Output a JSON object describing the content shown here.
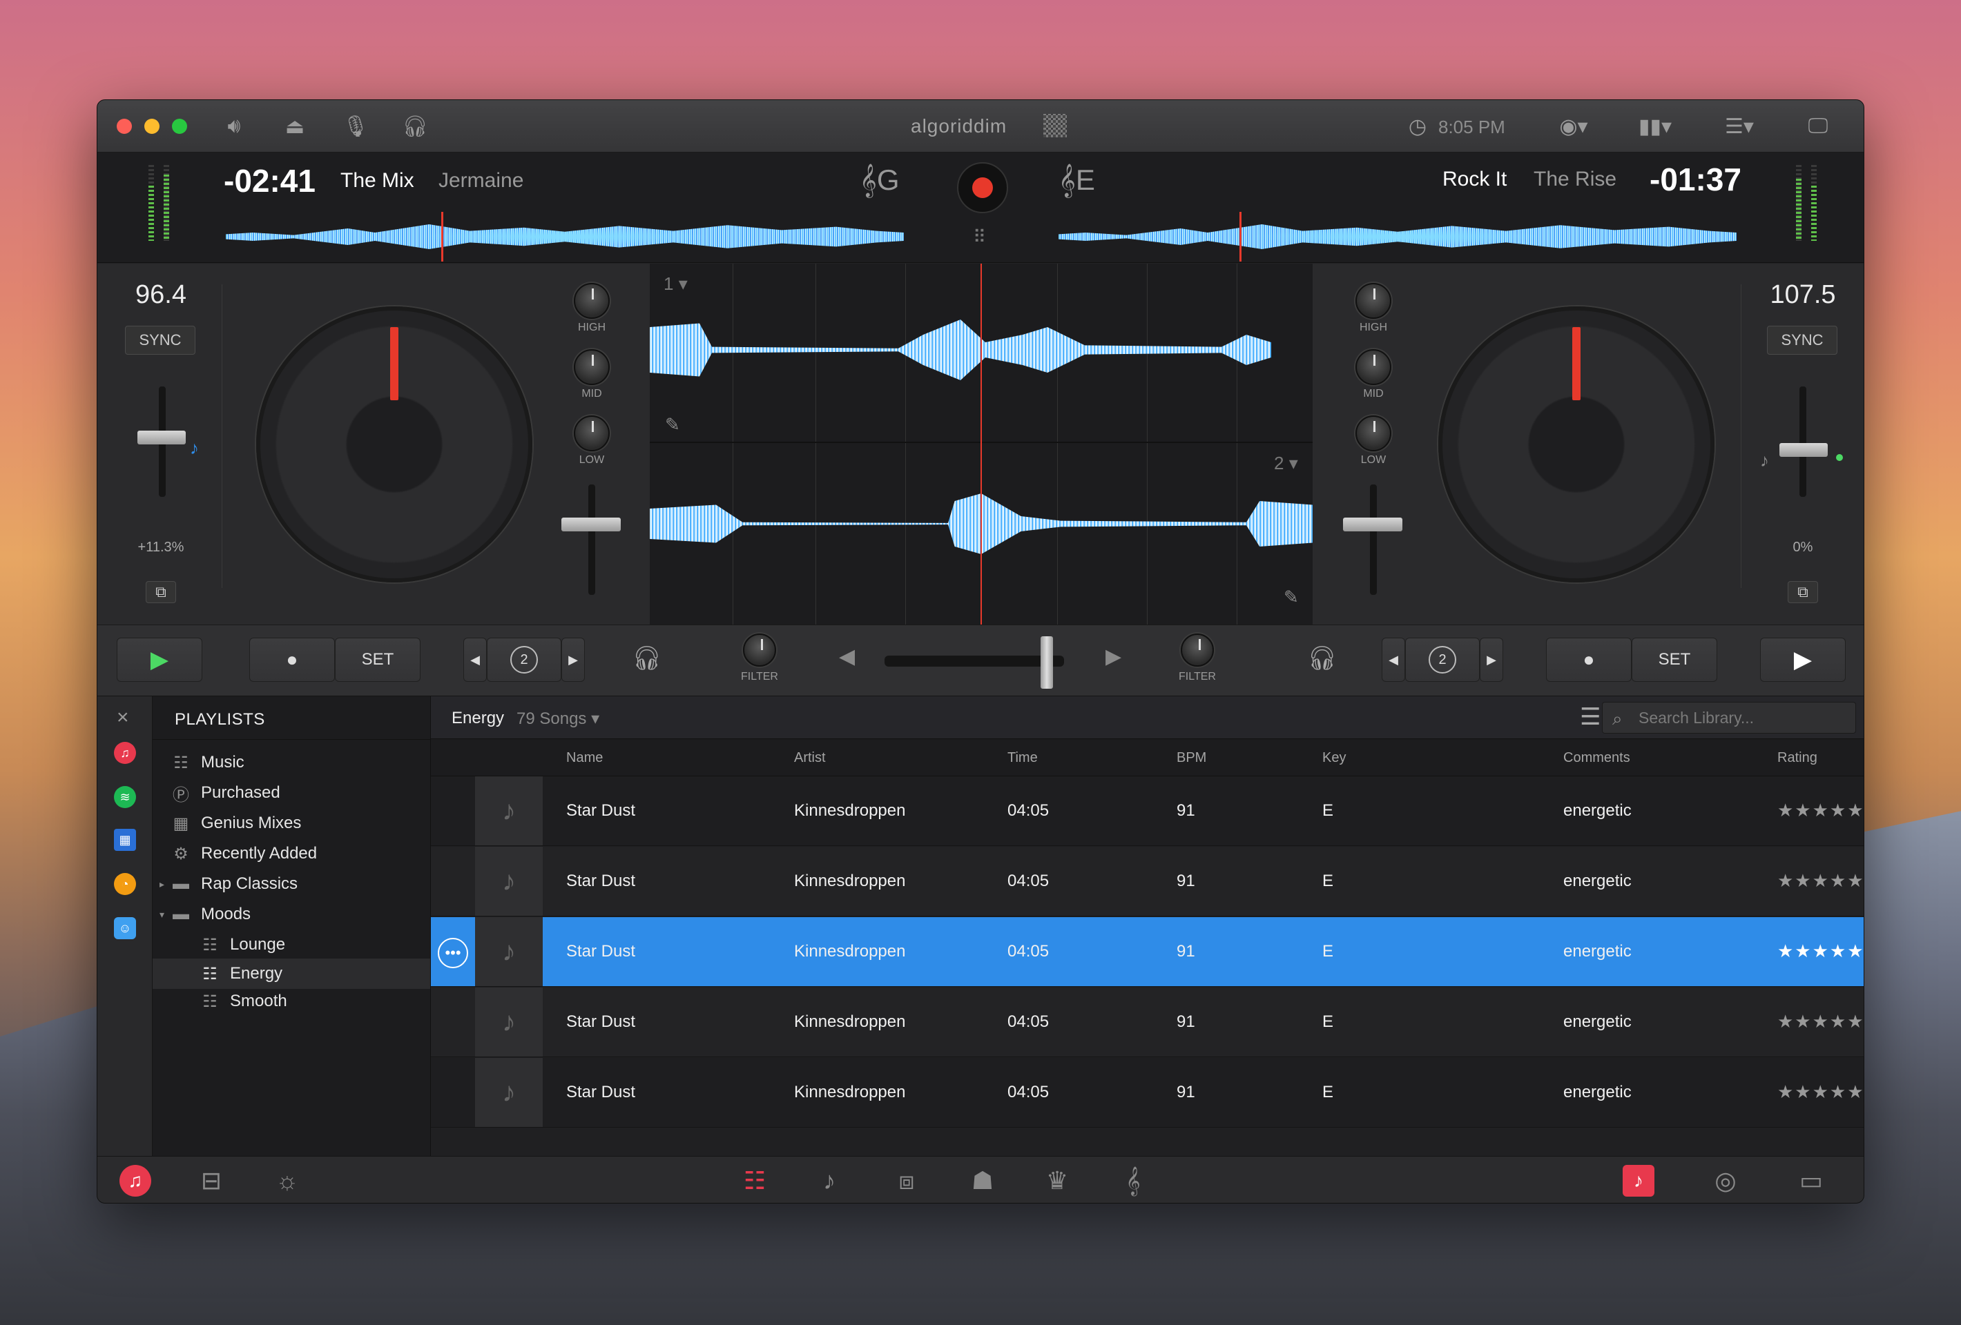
{
  "titlebar": {
    "app_logo": "algoriddim",
    "clock": "8:05 PM",
    "accent": "#e8392b"
  },
  "deck_left": {
    "time": "-02:41",
    "track": "The Mix",
    "artist": "Jermaine",
    "key": "G",
    "bpm": "96.4",
    "sync_label": "SYNC",
    "pitch": "+11.3%"
  },
  "deck_right": {
    "time": "-01:37",
    "track": "Rock It",
    "artist": "The Rise",
    "key": "E",
    "bpm": "107.5",
    "sync_label": "SYNC",
    "pitch": "0%"
  },
  "mixer": {
    "high": "HIGH",
    "mid": "MID",
    "low": "LOW",
    "filter": "FILTER",
    "deck1_num": "1",
    "deck2_num": "2"
  },
  "transport": {
    "set_label": "SET",
    "loop_value": "2"
  },
  "sources": [
    "itunes-icon",
    "spotify-icon",
    "video-icon",
    "history-icon",
    "finder-icon"
  ],
  "playlists": {
    "header": "PLAYLISTS",
    "items": [
      {
        "label": "Music",
        "icon": "playlist-icon"
      },
      {
        "label": "Purchased",
        "icon": "purchased-icon"
      },
      {
        "label": "Genius Mixes",
        "icon": "genius-icon"
      },
      {
        "label": "Recently Added",
        "icon": "gear-icon"
      },
      {
        "label": "Rap Classics",
        "icon": "folder-icon"
      },
      {
        "label": "Moods",
        "icon": "folder-icon"
      },
      {
        "label": "Lounge",
        "icon": "playlist-icon"
      },
      {
        "label": "Energy",
        "icon": "playlist-icon"
      },
      {
        "label": "Smooth",
        "icon": "playlist-icon"
      }
    ]
  },
  "library": {
    "playlist_name": "Energy",
    "song_count": "79 Songs",
    "search_placeholder": "Search Library...",
    "columns": [
      "Name",
      "Artist",
      "Time",
      "BPM",
      "Key",
      "Comments",
      "Rating"
    ],
    "rows": [
      {
        "name": "Star Dust",
        "artist": "Kinnesdroppen",
        "time": "04:05",
        "bpm": "91",
        "key": "E",
        "comments": "energetic",
        "rating": 5
      },
      {
        "name": "Star Dust",
        "artist": "Kinnesdroppen",
        "time": "04:05",
        "bpm": "91",
        "key": "E",
        "comments": "energetic",
        "rating": 5
      },
      {
        "name": "Star Dust",
        "artist": "Kinnesdroppen",
        "time": "04:05",
        "bpm": "91",
        "key": "E",
        "comments": "energetic",
        "rating": 5
      },
      {
        "name": "Star Dust",
        "artist": "Kinnesdroppen",
        "time": "04:05",
        "bpm": "91",
        "key": "E",
        "comments": "energetic",
        "rating": 5
      },
      {
        "name": "Star Dust",
        "artist": "Kinnesdroppen",
        "time": "04:05",
        "bpm": "91",
        "key": "E",
        "comments": "energetic",
        "rating": 5
      }
    ],
    "selected_row": 2,
    "selection_color": "#2f8ce8"
  },
  "bottombar": {
    "active_color": "#e8394d"
  }
}
